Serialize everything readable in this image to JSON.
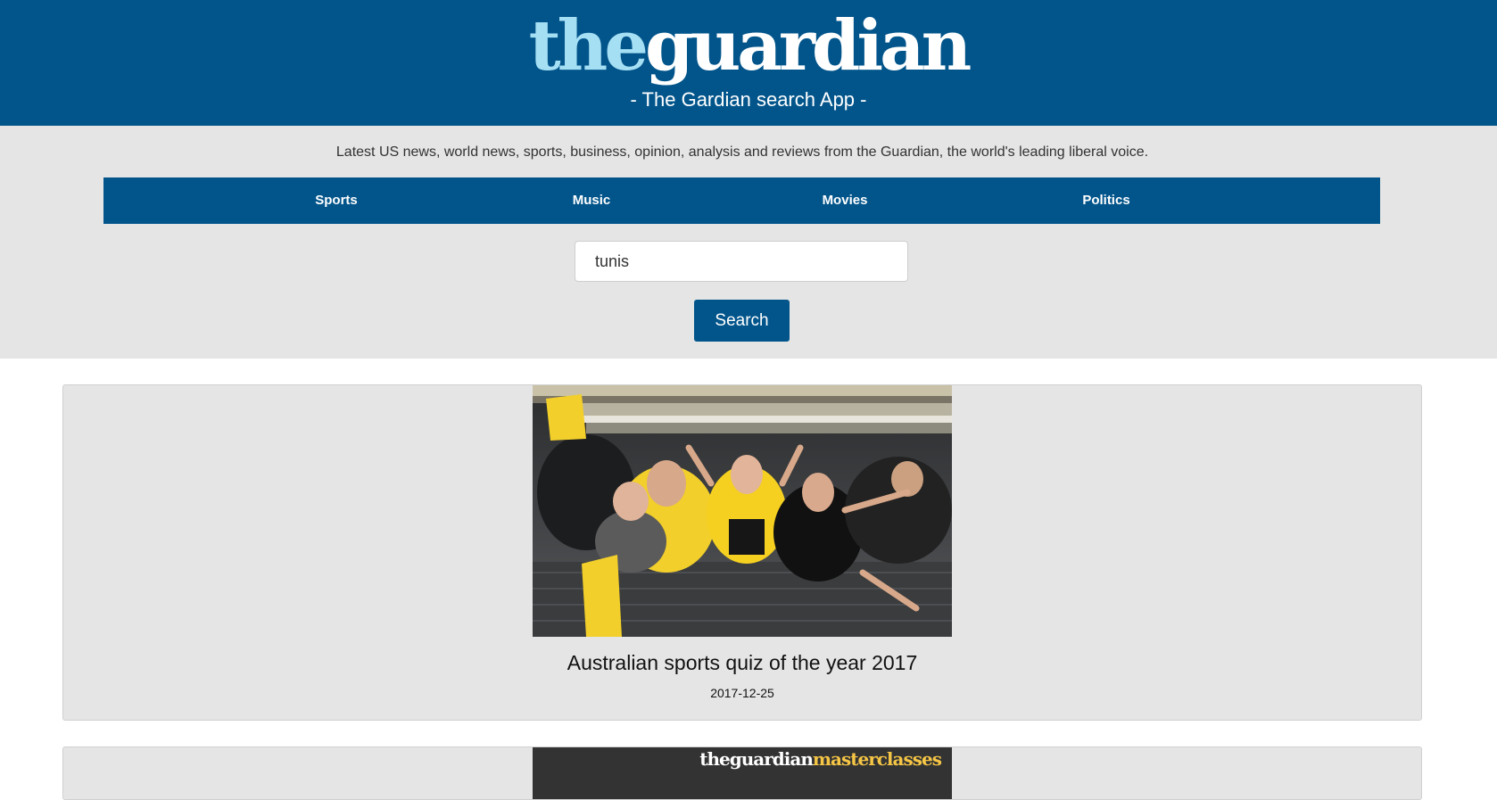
{
  "header": {
    "logo_the": "the",
    "logo_guardian": "guardian",
    "subtitle": "- The Gardian search App -"
  },
  "tagline": "Latest US news, world news, sports, business, opinion, analysis and reviews from the Guardian, the world's leading liberal voice.",
  "nav": {
    "items": [
      {
        "label": "Sports"
      },
      {
        "label": "Music"
      },
      {
        "label": "Movies"
      },
      {
        "label": "Politics"
      }
    ]
  },
  "search": {
    "value": "tunis",
    "button_label": "Search"
  },
  "results": [
    {
      "title": "Australian sports quiz of the year 2017",
      "date": "2017-12-25",
      "image": "photo of cheering sports fans in yellow and black"
    },
    {
      "image_logo_a": "theguardian",
      "image_logo_b": "masterclasses"
    }
  ],
  "colors": {
    "brand_blue": "#02558b",
    "logo_light_blue": "#a5dff4",
    "background_gray": "#e5e5e5",
    "masterclass_gold": "#f5c545"
  }
}
